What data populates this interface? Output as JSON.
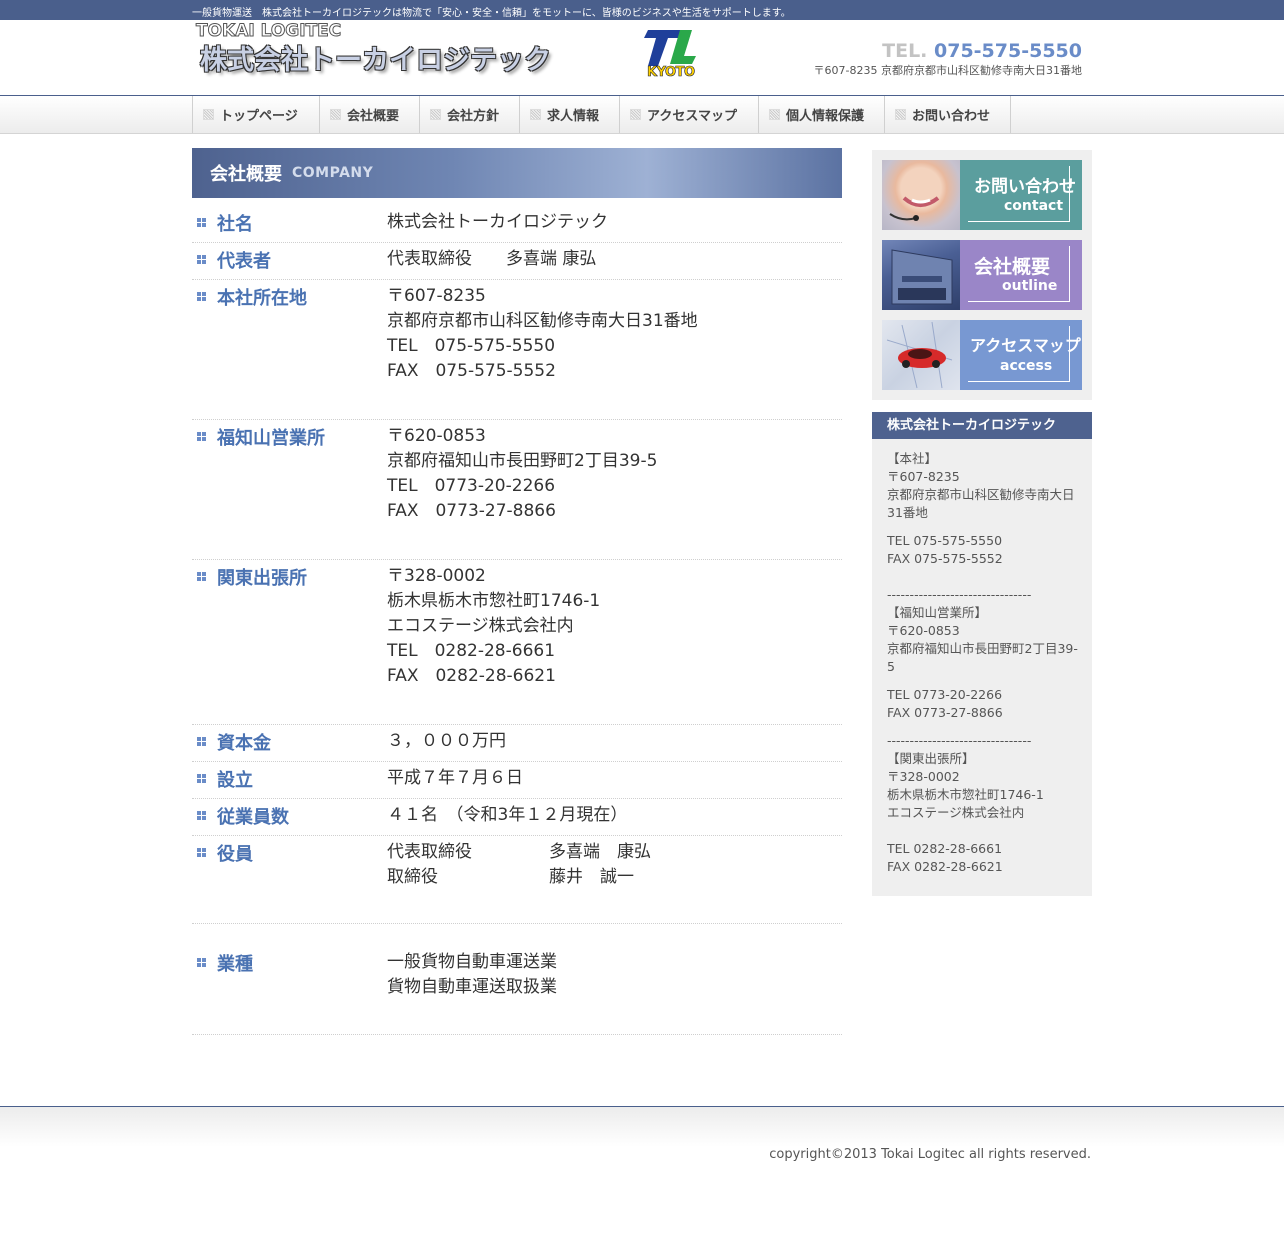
{
  "topbar": {
    "tagline": "一般貨物運送　株式会社トーカイロジテックは物流で「安心・安全・信頼」をモットーに、皆様のビジネスや生活をサポートします。"
  },
  "header": {
    "logo_en": "TOKAI LOGITEC",
    "logo_jp": "株式会社トーカイロジテック",
    "emblem_text": "KYOTO",
    "tel_prefix": "TEL.",
    "tel_number": "075-575-5550",
    "address": "〒607-8235 京都府京都市山科区勧修寺南大日31番地"
  },
  "nav": {
    "items": [
      "トップページ",
      "会社概要",
      "会社方針",
      "求人情報",
      "アクセスマップ",
      "個人情報保護",
      "お問い合わせ"
    ]
  },
  "main": {
    "title_jp": "会社概要",
    "title_en": "COMPANY",
    "rows": [
      {
        "label": "社名",
        "lines": [
          "株式会社トーカイロジテック"
        ]
      },
      {
        "label": "代表者",
        "lines": [
          "代表取締役　　多喜端 康弘"
        ]
      },
      {
        "label": "本社所在地",
        "lines": [
          "〒607-8235",
          "京都府京都市山科区勧修寺南大日31番地",
          "TEL　075-575-5550",
          "FAX　075-575-5552"
        ]
      },
      {
        "label": "福知山営業所",
        "lines": [
          "〒620-0853",
          "京都府福知山市長田野町2丁目39-5",
          "TEL　0773-20-2266",
          "FAX　0773-27-8866"
        ]
      },
      {
        "label": "関東出張所",
        "lines": [
          "〒328-0002",
          "栃木県栃木市惣社町1746-1",
          "エコステージ株式会社内",
          "TEL　0282-28-6661",
          "FAX　0282-28-6621"
        ]
      },
      {
        "label": "資本金",
        "lines": [
          "３，０００万円"
        ]
      },
      {
        "label": "設立",
        "lines": [
          "平成７年７月６日"
        ]
      },
      {
        "label": "従業員数",
        "lines": [
          "４１名　（令和3年１２月現在）"
        ]
      },
      {
        "label": "役員",
        "officers": [
          {
            "position": "代表取締役",
            "name": "多喜端　康弘"
          },
          {
            "position": "取締役",
            "name": "藤井　誠一"
          }
        ]
      },
      {
        "label": "業種",
        "lines": [
          "一般貨物自動車運送業",
          "貨物自動車運送取扱業"
        ]
      }
    ]
  },
  "sidebar": {
    "banners": [
      {
        "jp": "お問い合わせ",
        "en": "contact",
        "color": "#5b9e9e"
      },
      {
        "jp": "会社概要",
        "en": "outline",
        "color": "#9a86c8"
      },
      {
        "jp": "アクセスマップ",
        "en": "access",
        "color": "#7898d2"
      }
    ],
    "info_title": "株式会社トーカイロジテック",
    "info": {
      "hq_label": "【本社】",
      "hq_zip": "〒607-8235",
      "hq_addr": "京都府京都市山科区勧修寺南大日31番地",
      "hq_tel": "TEL 075-575-5550",
      "hq_fax": "FAX 075-575-5552",
      "divider": "--------------------------------",
      "fk_label": "【福知山営業所】",
      "fk_zip": "〒620-0853",
      "fk_addr": "京都府福知山市長田野町2丁目39-5",
      "fk_tel": "TEL 0773-20-2266",
      "fk_fax": "FAX 0773-27-8866",
      "kt_label": "【関東出張所】",
      "kt_zip": "〒328-0002",
      "kt_addr": "栃木県栃木市惣社町1746-1",
      "kt_addr2": "エコステージ株式会社内",
      "kt_tel": "TEL 0282-28-6661",
      "kt_fax": "FAX 0282-28-6621"
    }
  },
  "footer": {
    "copyright": "copyright©2013 Tokai Logitec all rights reserved."
  },
  "colors": {
    "brand_navy": "#4a5f8c",
    "label_blue": "#4a72b2",
    "tel_blue": "#6a8cc8"
  }
}
